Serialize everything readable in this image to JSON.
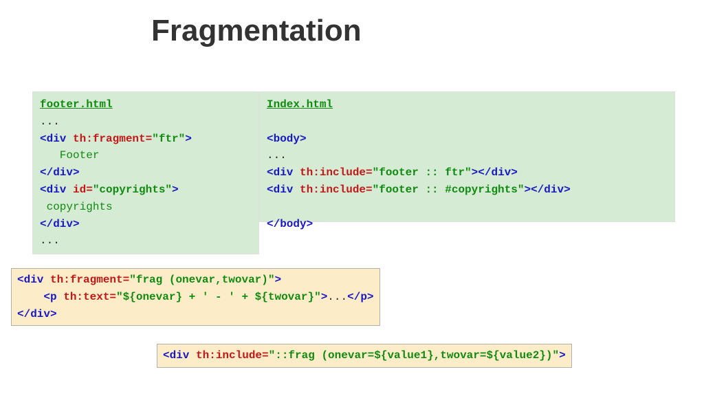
{
  "title": "Fragmentation",
  "footer": {
    "filename": "footer.html",
    "ellipsis1": "...",
    "div_open_frag": {
      "tag_open": "<div",
      "attr": " th:fragment=",
      "val": "\"ftr\"",
      "tag_close": ">"
    },
    "footer_text": "   Footer",
    "div_close1": "</div>",
    "div_open_id": {
      "tag_open": "<div",
      "attr": " id=",
      "val": "\"copyrights\"",
      "tag_close": ">"
    },
    "copy_text": " copyrights",
    "div_close2": "</div>",
    "ellipsis2": "..."
  },
  "index": {
    "filename": "Index.html",
    "blank1": " ",
    "body_open": "<body>",
    "ellipsis": "...",
    "inc1": {
      "tag_open": "<div",
      "attr": " th:include=",
      "val": "\"footer :: ftr\"",
      "tag_mid": ">",
      "close": "</div>"
    },
    "inc2": {
      "tag_open": "<div",
      "attr": " th:include=",
      "val": "\"footer :: #copyrights\"",
      "tag_mid": ">",
      "close": "</div>"
    },
    "blank2": " ",
    "body_close": "</body>"
  },
  "frag_def": {
    "div_open": {
      "tag_open": "<div",
      "attr": " th:fragment=",
      "val": "\"frag (onevar,twovar)\"",
      "tag_close": ">"
    },
    "p_line": {
      "indent": "    ",
      "p_open": "<p",
      "attr": " th:text=",
      "val": "\"${onevar} + ' - ' + ${twovar}\"",
      "p_mid": ">",
      "dots": "...",
      "p_close": "</p>"
    },
    "div_close": "</div>"
  },
  "frag_use": {
    "tag_open": "<div",
    "attr": " th:include=",
    "val": "\"::frag (onevar=${value1},twovar=${value2})\"",
    "tag_close": ">"
  }
}
